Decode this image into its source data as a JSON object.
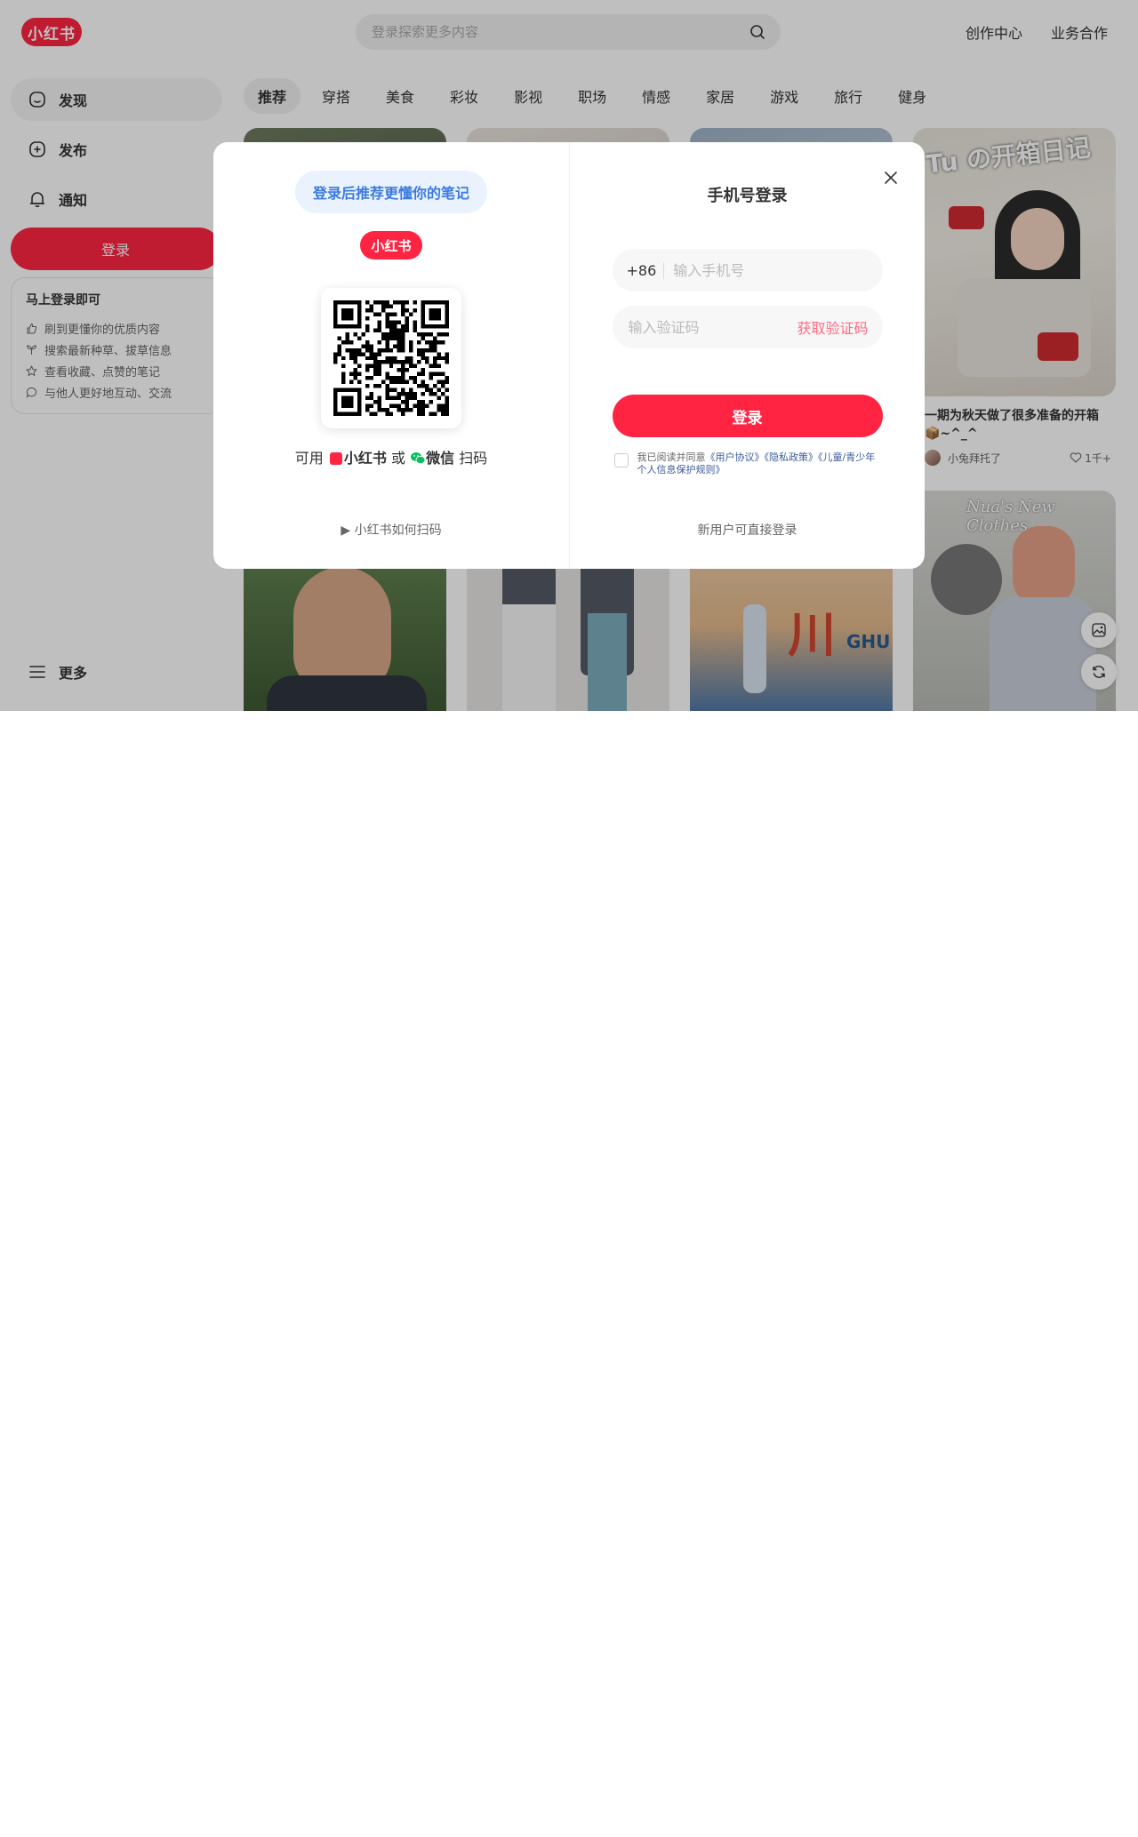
{
  "header": {
    "logo": "小红书",
    "search_placeholder": "登录探索更多内容",
    "links": [
      "创作中心",
      "业务合作"
    ]
  },
  "sidebar": {
    "items": [
      {
        "label": "发现",
        "icon": "discover-icon"
      },
      {
        "label": "发布",
        "icon": "plus-square-icon"
      },
      {
        "label": "通知",
        "icon": "bell-icon"
      }
    ],
    "login_label": "登录",
    "login_card": {
      "title": "马上登录即可",
      "rows": [
        "刷到更懂你的优质内容",
        "搜索最新种草、拔草信息",
        "查看收藏、点赞的笔记",
        "与他人更好地互动、交流"
      ]
    },
    "more_label": "更多"
  },
  "tabs": [
    "推荐",
    "穿搭",
    "美食",
    "彩妆",
    "影视",
    "职场",
    "情感",
    "家居",
    "游戏",
    "旅行",
    "健身"
  ],
  "feed": {
    "card_title": "一期为秋天做了很多准备的开箱 📦~^_^",
    "card_author": "小兔拜托了",
    "card_likes": "1千+",
    "image_text_1": "Tu の开箱日记",
    "image_text_2": "Nua's New Clothes",
    "image_text_3": "川",
    "image_text_4": "GHU"
  },
  "modal": {
    "left": {
      "tip": "登录后推荐更懂你的笔记",
      "logo": "小红书",
      "scan_prefix": "可用",
      "scan_app1": "小红书",
      "scan_or": "或",
      "scan_app2": "微信",
      "scan_suffix": "扫码",
      "how_to": "▶ 小红书如何扫码"
    },
    "right": {
      "title": "手机号登录",
      "country_code": "+86",
      "phone_placeholder": "输入手机号",
      "code_placeholder": "输入验证码",
      "get_code": "获取验证码",
      "login_button": "登录",
      "agree_prefix": "我已阅读并同意",
      "agree_link1": "《用户协议》",
      "agree_link2": "《隐私政策》",
      "agree_link3": "《儿童/青少年个人信息保护规则》",
      "new_user": "新用户可直接登录"
    }
  },
  "colors": {
    "brand": "#ff2442",
    "tip_bg": "#eaf2fe",
    "tip_text": "#3b7be0"
  }
}
